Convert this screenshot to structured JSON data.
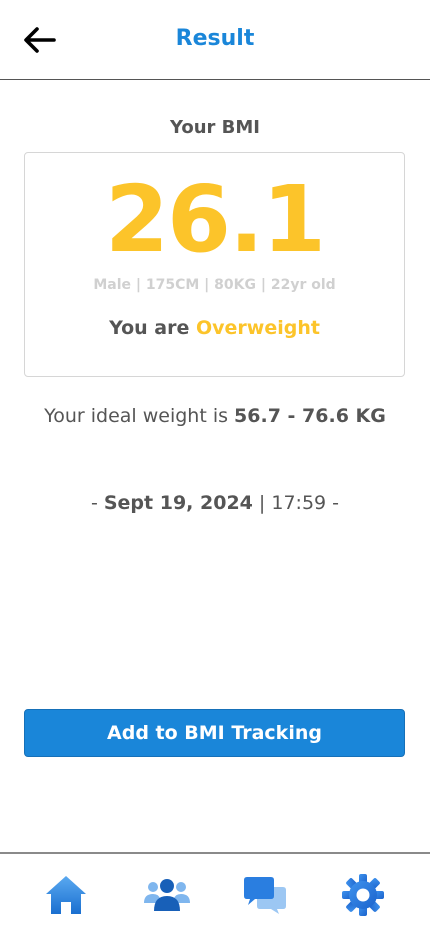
{
  "header": {
    "title": "Result",
    "back_icon": "arrow-left-icon"
  },
  "result": {
    "caption": "Your BMI",
    "bmi_value": "26.1",
    "details": "Male | 175CM | 80KG | 22yr old",
    "status_prefix": "You are ",
    "status": "Overweight",
    "status_color": "#FCC42A"
  },
  "ideal_weight": {
    "prefix": "Your ideal weight is ",
    "range": "56.7 - 76.6 KG"
  },
  "timestamp": {
    "lead": "- ",
    "date": "Sept 19, 2024",
    "separator": " | ",
    "time": "17:59",
    "trail": " -"
  },
  "actions": {
    "track_label": "Add to BMI Tracking"
  },
  "nav": {
    "items": [
      {
        "icon": "home-icon"
      },
      {
        "icon": "community-icon"
      },
      {
        "icon": "chat-icon"
      },
      {
        "icon": "settings-gear-icon"
      }
    ]
  },
  "colors": {
    "accent": "#1A86D9",
    "highlight": "#FCC42A",
    "text": "#555555"
  }
}
